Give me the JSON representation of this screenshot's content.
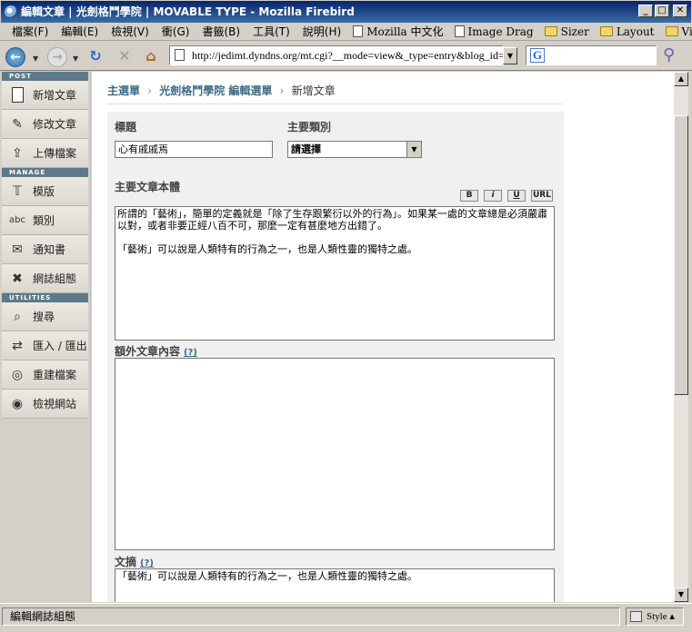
{
  "window": {
    "title": "編輯文章 | 光劍格鬥學院 | MOVABLE TYPE - Mozilla Firebird",
    "minimize": "_",
    "maximize": "□",
    "close": "✕"
  },
  "menubar": {
    "items": [
      "檔案(F)",
      "編輯(E)",
      "檢視(V)",
      "衝(G)",
      "書籤(B)",
      "工具(T)",
      "說明(H)"
    ],
    "bookmarks": [
      "Mozilla 中文化",
      "Image Drag",
      "Sizer",
      "Layout",
      "View"
    ],
    "overflow": "»"
  },
  "nav": {
    "url": "http://jedimt.dyndns.org/mt.cgi?__mode=view&_type=entry&blog_id=1",
    "search_value": "",
    "search_engine_icon": "G"
  },
  "sidebar": {
    "sections": [
      {
        "heading": "POST",
        "items": [
          {
            "label": "新增文章",
            "icon": "new-document-icon"
          },
          {
            "label": "修改文章",
            "icon": "edit-document-icon"
          },
          {
            "label": "上傳檔案",
            "icon": "upload-icon"
          }
        ]
      },
      {
        "heading": "MANAGE",
        "items": [
          {
            "label": "模版",
            "icon": "template-icon"
          },
          {
            "label": "類別",
            "icon": "category-icon"
          },
          {
            "label": "通知書",
            "icon": "mail-icon"
          },
          {
            "label": "網誌組態",
            "icon": "tools-icon"
          }
        ]
      },
      {
        "heading": "UTILITIES",
        "items": [
          {
            "label": "搜尋",
            "icon": "search-icon"
          },
          {
            "label": "匯入 / 匯出",
            "icon": "import-export-icon"
          },
          {
            "label": "重建檔案",
            "icon": "rebuild-icon"
          },
          {
            "label": "檢視網站",
            "icon": "view-site-icon"
          }
        ]
      }
    ]
  },
  "breadcrumb": {
    "home": "主選單",
    "blog": "光劍格鬥學院 編輯選單",
    "current": "新增文章",
    "separator": "›"
  },
  "form": {
    "title_label": "標題",
    "title_value": "心有戚戚焉",
    "category_label": "主要類別",
    "category_value": "請選擇",
    "body_label": "主要文章本體",
    "format_buttons": [
      "B",
      "i",
      "U",
      "URL"
    ],
    "body_text": "所謂的「藝術」，簡單的定義就是「除了生存跟繁衍以外的行為」。如果某一處的文章總是必須嚴肅以對，或者非要正經八百不可，那麼一定有甚麼地方出錯了。\n\n「藝術」可以說是人類特有的行為之一，也是人類性靈的獨特之處。",
    "extended_label": "額外文章內容",
    "extended_help": "(?)",
    "extended_text": "",
    "excerpt_label": "文摘",
    "excerpt_help": "(?)",
    "excerpt_text": "「藝術」可以說是人類特有的行為之一，也是人類性靈的獨特之處。"
  },
  "statusbar": {
    "text": "編輯網誌組態",
    "style_label": "Style ▴"
  }
}
